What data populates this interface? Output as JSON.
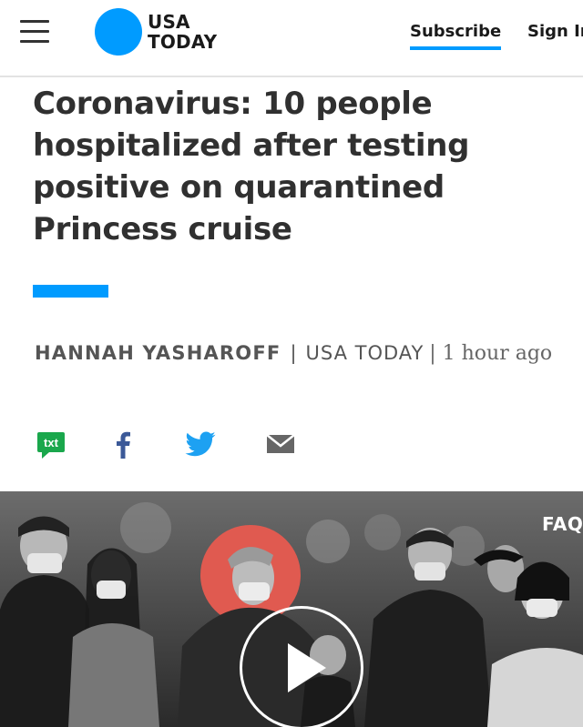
{
  "header": {
    "logo_line1": "USA",
    "logo_line2": "TODAY",
    "subscribe_label": "Subscribe",
    "signin_label": "Sign In",
    "menu_icon": "hamburger-menu-icon",
    "accent_color": "#009bff"
  },
  "article": {
    "headline": "Coronavirus: 10 people hospitalized after testing positive on quarantined Princess cruise",
    "author": "HANNAH YASHAROFF",
    "separator": "|",
    "source": "USA TODAY",
    "timestamp": "| 1 hour ago"
  },
  "share": {
    "txt_label": "txt",
    "icons": [
      "sms-icon",
      "facebook-icon",
      "twitter-icon",
      "email-icon"
    ],
    "colors": {
      "sms": "#1aa74c",
      "facebook": "#3b5998",
      "twitter": "#1da1f2",
      "email": "#666666"
    }
  },
  "video": {
    "overlay_label": "FAQ",
    "play_icon": "play-icon",
    "highlight_color": "#e05a50"
  }
}
